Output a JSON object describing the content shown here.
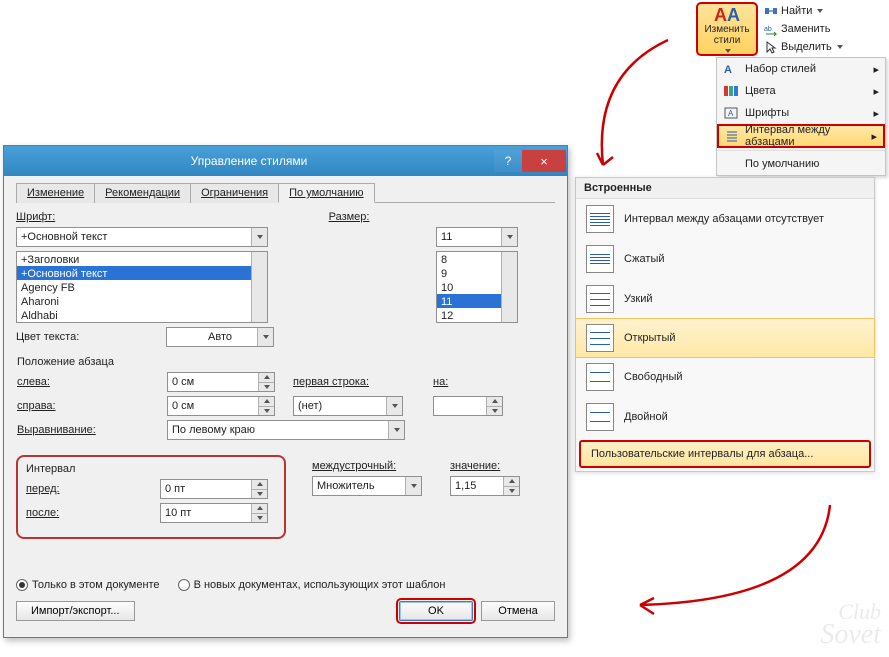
{
  "ribbon": {
    "change_styles_icon_alt": "AA",
    "change_styles_label": "Изменить\nстили",
    "find": "Найти",
    "replace": "Заменить",
    "select": "Выделить"
  },
  "styles_menu": {
    "items": [
      "Набор стилей",
      "Цвета",
      "Шрифты",
      "Интервал между абзацами",
      "По умолчанию"
    ]
  },
  "builtin": {
    "header": "Встроенные",
    "items": [
      "Интервал между абзацами отсутствует",
      "Сжатый",
      "Узкий",
      "Открытый",
      "Свободный",
      "Двойной"
    ],
    "selected_index": 3,
    "custom": "Пользовательские интервалы для абзаца..."
  },
  "dialog": {
    "title": "Управление стилями",
    "help": "?",
    "close": "×",
    "tabs": [
      "Изменение",
      "Рекомендации",
      "Ограничения",
      "По умолчанию"
    ],
    "active_tab": 3,
    "font_label": "Шрифт:",
    "font_value": "+Основной текст",
    "font_list": [
      "+Заголовки",
      "+Основной текст",
      "Agency FB",
      "Aharoni",
      "Aldhabi"
    ],
    "font_list_selected": 1,
    "size_label": "Размер:",
    "size_value": "11",
    "size_list": [
      "8",
      "9",
      "10",
      "11",
      "12"
    ],
    "size_list_selected": 3,
    "text_color_label": "Цвет текста:",
    "text_color_value": "Авто",
    "paragraph_position_label": "Положение абзаца",
    "left_label": "слева:",
    "left_value": "0 см",
    "right_label": "справа:",
    "right_value": "0 см",
    "firstline_label": "первая строка:",
    "firstline_value": "(нет)",
    "by1_label": "на:",
    "by1_value": "",
    "align_label": "Выравнивание:",
    "align_value": "По левому краю",
    "interval_label": "Интервал",
    "before_label": "перед:",
    "before_value": "0 пт",
    "after_label": "после:",
    "after_value": "10 пт",
    "linespacing_label": "междустрочный:",
    "linespacing_value": "Множитель",
    "by2_label": "значение:",
    "by2_value": "1,15",
    "radio_this_doc": "Только в этом документе",
    "radio_new_docs": "В новых документах, использующих этот шаблон",
    "import_export": "Импорт/экспорт...",
    "ok": "OK",
    "cancel": "Отмена"
  },
  "watermark": {
    "line1": "Club",
    "line2": "Sovet"
  }
}
